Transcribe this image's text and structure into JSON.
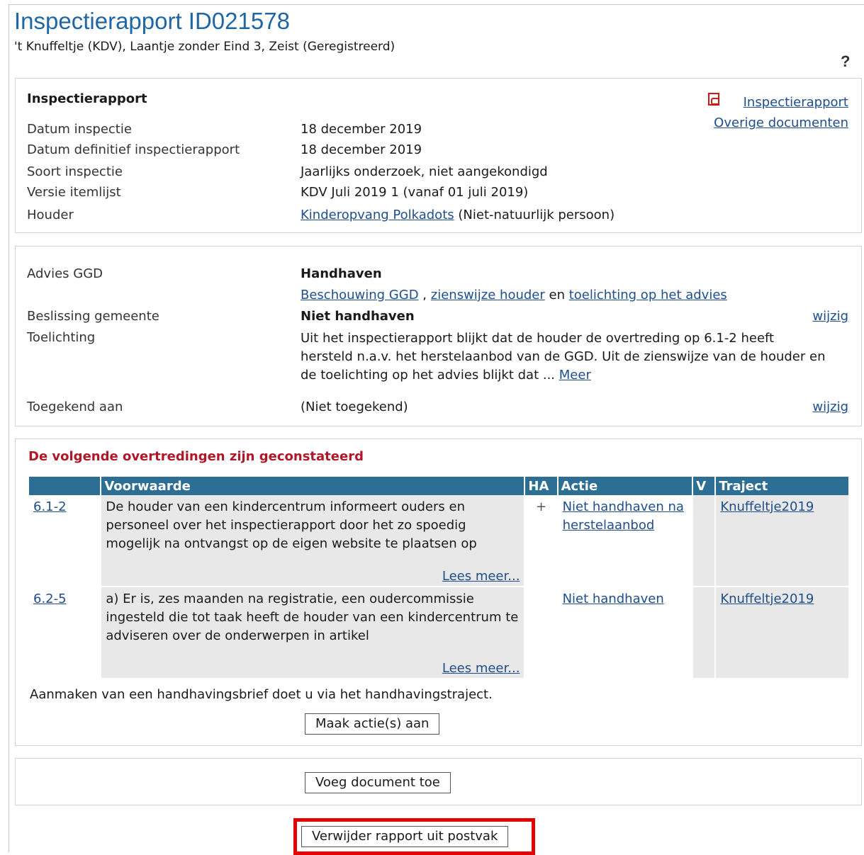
{
  "header": {
    "title": "Inspectierapport ID021578",
    "subtitle": "'t Knuffeltje (KDV), Laantje zonder Eind 3, Zeist (Geregistreerd)",
    "help_symbol": "?"
  },
  "report_panel": {
    "heading": "Inspectierapport",
    "links": {
      "report": "Inspectierapport",
      "other_docs": "Overige documenten"
    },
    "fields": [
      {
        "label": "Datum inspectie",
        "value": "18 december 2019"
      },
      {
        "label": "Datum definitief inspectierapport",
        "value": "18 december 2019"
      },
      {
        "label": "Soort inspectie",
        "value": "Jaarlijks onderzoek, niet aangekondigd"
      },
      {
        "label": "Versie itemlijst",
        "value": "KDV Juli 2019 1 (vanaf 01 juli 2019)"
      }
    ],
    "houder": {
      "label": "Houder",
      "link": "Kinderopvang Polkadots",
      "suffix": "(Niet-natuurlijk persoon)"
    }
  },
  "advice_panel": {
    "advies_label": "Advies GGD",
    "advies_value": "Handhaven",
    "advies_links": {
      "beschouwing": "Beschouwing GGD",
      "comma": ",",
      "zienswijze": "zienswijze houder",
      "en": "en",
      "toelichting": "toelichting op het advies"
    },
    "beslissing_label": "Beslissing gemeente",
    "beslissing_value": "Niet handhaven",
    "edit_label": "wijzig",
    "toelichting_label": "Toelichting",
    "toelichting_text": "Uit het inspectierapport blijkt dat de houder de overtreding op 6.1-2 heeft hersteld n.a.v. het herstelaanbod van de GGD. Uit de zienswijze van de houder en de toelichting op het advies blijkt dat ...",
    "meer_link": "Meer",
    "toegekend_label": "Toegekend aan",
    "toegekend_value": "(Niet toegekend)"
  },
  "violations_panel": {
    "heading": "De volgende overtredingen zijn geconstateerd",
    "columns": {
      "code": "",
      "voorwaarde": "Voorwaarde",
      "ha": "HA",
      "actie": "Actie",
      "v": "V",
      "traject": "Traject"
    },
    "rows": [
      {
        "code": "6.1-2",
        "voorwaarde": "De houder van een kindercentrum informeert ouders en personeel over het inspectierapport door het zo spoedig mogelijk na ontvangst op de eigen website te plaatsen op",
        "ha": "+",
        "actie": "Niet handhaven na herstelaanbod",
        "v": "",
        "traject": "Knuffeltje2019"
      },
      {
        "code": "6.2-5",
        "voorwaarde": "a) Er is, zes maanden na registratie, een oudercommissie ingesteld die tot taak heeft de houder van een kindercentrum te adviseren over de onderwerpen in artikel",
        "ha": "",
        "actie": "Niet handhaven",
        "v": "",
        "traject": "Knuffeltje2019"
      }
    ],
    "lees_meer": "Lees meer...",
    "brief_note": "Aanmaken van een handhavingsbrief doet u via het handhavingstraject.",
    "create_action_button": "Maak actie(s) aan"
  },
  "documents_panel": {
    "add_document_button": "Voeg document toe"
  },
  "footer": {
    "remove_button": "Verwijder rapport uit postvak",
    "highlight_color": "#e30000"
  }
}
